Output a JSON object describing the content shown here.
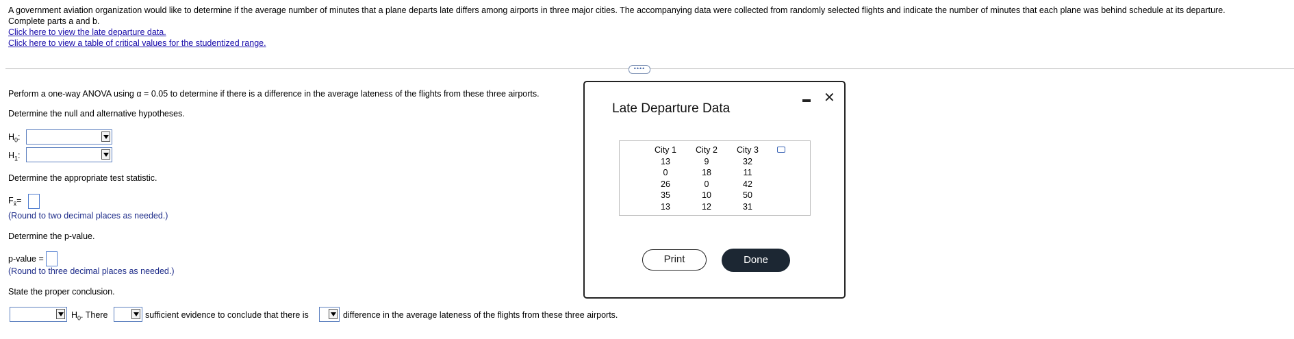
{
  "intro": {
    "text": "A government aviation organization would like to determine if the average number of minutes that a plane departs late differs among airports in three major cities. The accompanying data were collected from randomly selected flights and indicate the number of minutes that each plane was behind schedule at its departure.",
    "parts": "Complete parts a and b.",
    "link1": "Click here to view the late departure data.",
    "link2": "Click here to view a table of critical values for the studentized range."
  },
  "expand_button": "••••",
  "question": {
    "perform": "Perform a one-way ANOVA using α = 0.05 to determine if there is a difference in the average lateness of the flights from these three airports.",
    "hyp_prompt": "Determine the null and alternative hypotheses.",
    "h0_label": "H",
    "h0_sub": "0",
    "h1_label": "H",
    "h1_sub": "1",
    "colon": ":",
    "stat_prompt": "Determine the appropriate test statistic.",
    "f_label": "F",
    "f_sub": "x̄",
    "equals": "=",
    "round_two": "(Round to two decimal places as needed.)",
    "p_prompt": "Determine the p-value.",
    "p_label": "p-value =",
    "round_three": "(Round to three decimal places as needed.)",
    "conclusion_prompt": "State the proper conclusion.",
    "concl_h": "H",
    "concl_sub": "0",
    "concl_there": ". There",
    "concl_sufficient": "sufficient evidence to conclude that there is",
    "concl_tail": "difference in the average lateness of the flights from these three airports."
  },
  "modal": {
    "title": "Late Departure Data",
    "columns": [
      {
        "header": "City 1",
        "values": [
          "13",
          "0",
          "26",
          "35",
          "13"
        ]
      },
      {
        "header": "City 2",
        "values": [
          "9",
          "18",
          "0",
          "10",
          "12"
        ]
      },
      {
        "header": "City 3",
        "values": [
          "32",
          "11",
          "42",
          "50",
          "31"
        ]
      }
    ],
    "print_label": "Print",
    "done_label": "Done",
    "close_glyph": "✕"
  },
  "colors": {
    "link": "#1a0dab",
    "hint": "#1f2d8a",
    "done_bg": "#1c2733"
  }
}
